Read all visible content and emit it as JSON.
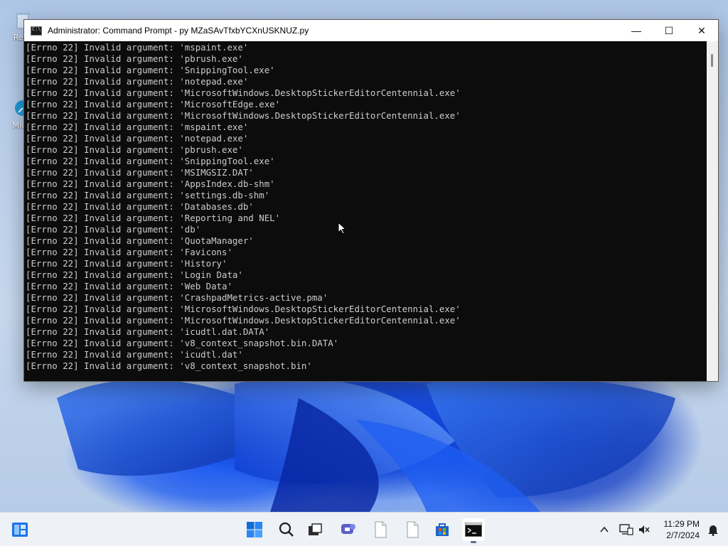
{
  "window": {
    "title": "Administrator: Command Prompt - py  MZaSAvTfxbYCXnUSKNUZ.py",
    "minimize_glyph": "—",
    "maximize_glyph": "☐",
    "close_glyph": "✕"
  },
  "console": {
    "lines": [
      "[Errno 22] Invalid argument: 'mspaint.exe'",
      "[Errno 22] Invalid argument: 'pbrush.exe'",
      "[Errno 22] Invalid argument: 'SnippingTool.exe'",
      "[Errno 22] Invalid argument: 'notepad.exe'",
      "[Errno 22] Invalid argument: 'MicrosoftWindows.DesktopStickerEditorCentennial.exe'",
      "[Errno 22] Invalid argument: 'MicrosoftEdge.exe'",
      "[Errno 22] Invalid argument: 'MicrosoftWindows.DesktopStickerEditorCentennial.exe'",
      "[Errno 22] Invalid argument: 'mspaint.exe'",
      "[Errno 22] Invalid argument: 'notepad.exe'",
      "[Errno 22] Invalid argument: 'pbrush.exe'",
      "[Errno 22] Invalid argument: 'SnippingTool.exe'",
      "[Errno 22] Invalid argument: 'MSIMGSIZ.DAT'",
      "[Errno 22] Invalid argument: 'AppsIndex.db-shm'",
      "[Errno 22] Invalid argument: 'settings.db-shm'",
      "[Errno 22] Invalid argument: 'Databases.db'",
      "[Errno 22] Invalid argument: 'Reporting and NEL'",
      "[Errno 22] Invalid argument: 'db'",
      "[Errno 22] Invalid argument: 'QuotaManager'",
      "[Errno 22] Invalid argument: 'Favicons'",
      "[Errno 22] Invalid argument: 'History'",
      "[Errno 22] Invalid argument: 'Login Data'",
      "[Errno 22] Invalid argument: 'Web Data'",
      "[Errno 22] Invalid argument: 'CrashpadMetrics-active.pma'",
      "[Errno 22] Invalid argument: 'MicrosoftWindows.DesktopStickerEditorCentennial.exe'",
      "[Errno 22] Invalid argument: 'MicrosoftWindows.DesktopStickerEditorCentennial.exe'",
      "[Errno 22] Invalid argument: 'icudtl.dat.DATA'",
      "[Errno 22] Invalid argument: 'v8_context_snapshot.bin.DATA'",
      "[Errno 22] Invalid argument: 'icudtl.dat'",
      "[Errno 22] Invalid argument: 'v8_context_snapshot.bin'"
    ]
  },
  "desktop": {
    "icons": [
      {
        "label": "Recy",
        "icon": "recycle-bin-icon"
      },
      {
        "label": "Mic E",
        "icon": "edge-shortcut-icon"
      }
    ]
  },
  "taskbar": {
    "apps": [
      {
        "icon": "windows-start-icon"
      },
      {
        "icon": "search-icon"
      },
      {
        "icon": "task-view-icon"
      },
      {
        "icon": "teams-chat-icon"
      },
      {
        "icon": "file-icon"
      },
      {
        "icon": "file-icon"
      },
      {
        "icon": "store-icon"
      },
      {
        "icon": "command-prompt-icon",
        "active": true
      }
    ],
    "clock": {
      "time": "11:29 PM",
      "date": "2/7/2024"
    }
  },
  "colors": {
    "console_bg": "#0c0c0c",
    "console_fg": "#cccccc",
    "taskbar_bg": "#eef1f6"
  }
}
